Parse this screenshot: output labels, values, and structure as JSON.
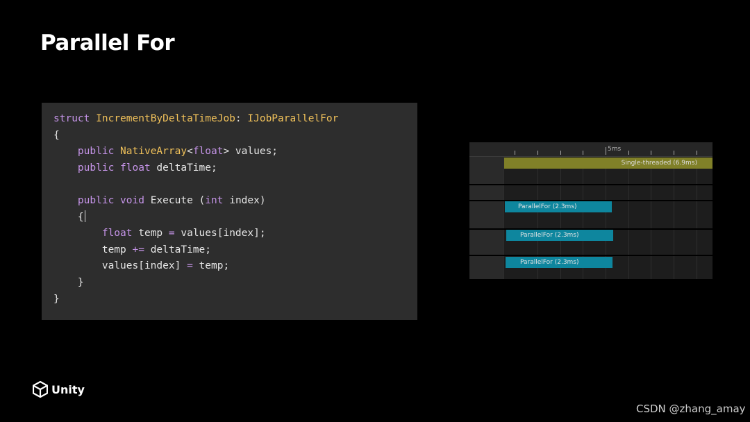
{
  "slide": {
    "title": "Parallel For"
  },
  "code": {
    "lines": [
      [
        {
          "t": "struct",
          "c": "kw"
        },
        {
          "t": " ",
          "c": "tx"
        },
        {
          "t": "IncrementByDeltaTimeJob",
          "c": "ty"
        },
        {
          "t": ": ",
          "c": "tx"
        },
        {
          "t": "IJobParallelFor",
          "c": "ty"
        }
      ],
      [
        {
          "t": "{",
          "c": "tx"
        }
      ],
      [
        {
          "t": "    ",
          "c": "tx"
        },
        {
          "t": "public",
          "c": "kw"
        },
        {
          "t": " ",
          "c": "tx"
        },
        {
          "t": "NativeArray",
          "c": "ty"
        },
        {
          "t": "<",
          "c": "tx"
        },
        {
          "t": "float",
          "c": "kw"
        },
        {
          "t": "> values;",
          "c": "tx"
        }
      ],
      [
        {
          "t": "    ",
          "c": "tx"
        },
        {
          "t": "public",
          "c": "kw"
        },
        {
          "t": " ",
          "c": "tx"
        },
        {
          "t": "float",
          "c": "kw"
        },
        {
          "t": " deltaTime;",
          "c": "tx"
        }
      ],
      [],
      [
        {
          "t": "    ",
          "c": "tx"
        },
        {
          "t": "public",
          "c": "kw"
        },
        {
          "t": " ",
          "c": "tx"
        },
        {
          "t": "void",
          "c": "kw"
        },
        {
          "t": " Execute (",
          "c": "tx"
        },
        {
          "t": "int",
          "c": "kw"
        },
        {
          "t": " index)",
          "c": "tx"
        }
      ],
      [
        {
          "t": "    ",
          "c": "tx"
        },
        {
          "t": "{",
          "c": "tx"
        },
        {
          "t": "",
          "c": "caret"
        }
      ],
      [
        {
          "t": "        ",
          "c": "tx"
        },
        {
          "t": "float",
          "c": "kw"
        },
        {
          "t": " temp ",
          "c": "tx"
        },
        {
          "t": "=",
          "c": "op"
        },
        {
          "t": " values[index];",
          "c": "tx"
        }
      ],
      [
        {
          "t": "        ",
          "c": "tx"
        },
        {
          "t": "temp ",
          "c": "tx"
        },
        {
          "t": "+=",
          "c": "op"
        },
        {
          "t": " deltaTime;",
          "c": "tx"
        }
      ],
      [
        {
          "t": "        ",
          "c": "tx"
        },
        {
          "t": "values[index] ",
          "c": "tx"
        },
        {
          "t": "=",
          "c": "op"
        },
        {
          "t": " temp;",
          "c": "tx"
        }
      ],
      [
        {
          "t": "    ",
          "c": "tx"
        },
        {
          "t": "}",
          "c": "tx"
        }
      ],
      [
        {
          "t": "}",
          "c": "tx"
        }
      ]
    ]
  },
  "profiler": {
    "ruler_label": "5ms",
    "single_bar": "Single-threaded (6.9ms)",
    "parallel_bars": [
      "ParallelFor (2.3ms)",
      "ParallelFor (2.3ms)",
      "ParallelFor (2.3ms)"
    ],
    "colors": {
      "single": "#808028",
      "parallel": "#0e869e"
    }
  },
  "footer": {
    "logo_text": "Unity",
    "logo_icon": "unity-cube-icon",
    "watermark": "CSDN @zhang_amay"
  }
}
